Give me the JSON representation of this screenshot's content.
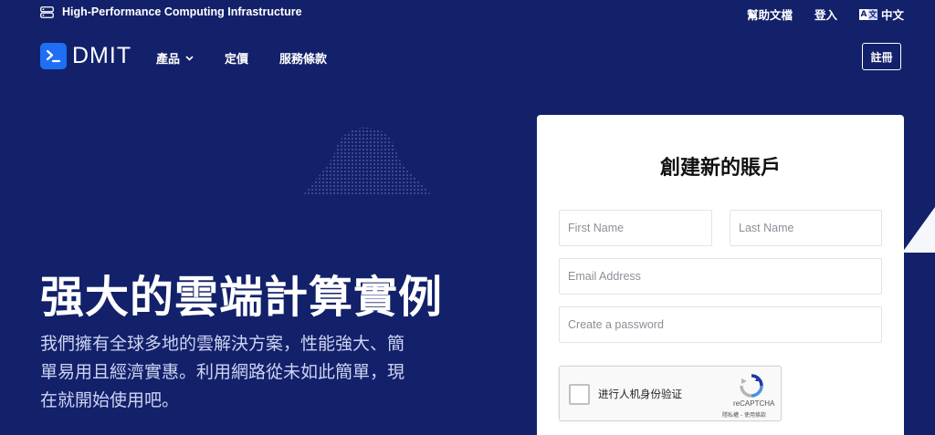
{
  "topbar": {
    "tagline": "High-Performance Computing Infrastructure",
    "links": {
      "docs": "幫助文檔",
      "login": "登入",
      "language": "中文"
    }
  },
  "nav": {
    "logo_text": "DMIT",
    "menu": {
      "products": "產品",
      "pricing": "定價",
      "terms": "服務條款"
    },
    "signup": "註冊"
  },
  "hero": {
    "title": "强大的雲端計算實例",
    "subtitle": "我們擁有全球多地的雲解決方案，性能強大、簡單易用且經濟實惠。利用網路從未如此簡單，現在就開始使用吧。"
  },
  "form": {
    "title": "創建新的賬戶",
    "first_name_placeholder": "First Name",
    "last_name_placeholder": "Last Name",
    "email_placeholder": "Email Address",
    "password_placeholder": "Create a password",
    "captcha": {
      "label": "进行人机身份验证",
      "brand": "reCAPTCHA",
      "terms": "隱私權 - 使用條款"
    }
  },
  "colors": {
    "background": "#13216a",
    "logo_blue": "#1f6ff5",
    "card": "#ffffff"
  },
  "icons": {
    "tagline": "server-icon",
    "language": "translate-icon",
    "products_menu": "chevron-down-icon",
    "captcha": "recaptcha-icon"
  }
}
